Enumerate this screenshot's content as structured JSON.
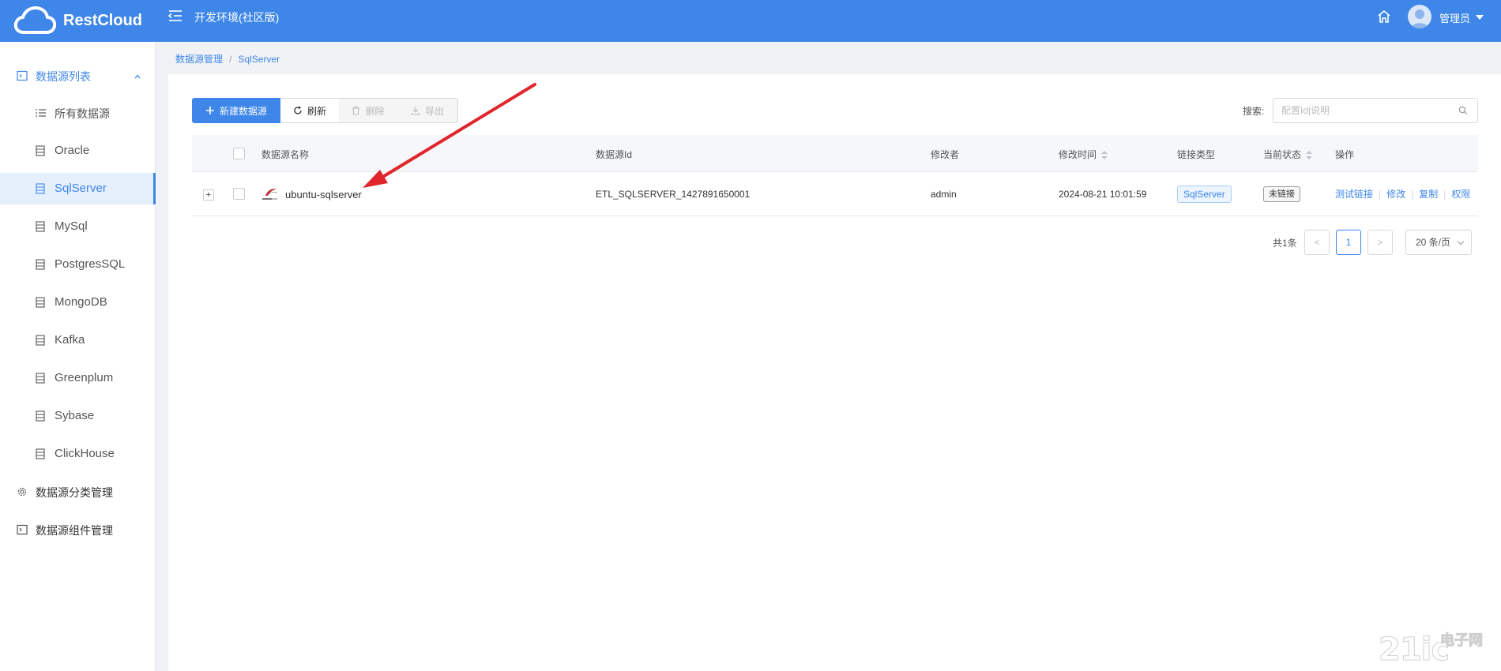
{
  "header": {
    "brand": "RestCloud",
    "env_title": "开发环境(社区版)",
    "user_name": "管理员"
  },
  "sidebar": {
    "group_datasource_list": "数据源列表",
    "items": [
      {
        "label": "所有数据源",
        "icon": "list-icon"
      },
      {
        "label": "Oracle",
        "icon": "db-icon"
      },
      {
        "label": "SqlServer",
        "icon": "db-icon",
        "active": true
      },
      {
        "label": "MySql",
        "icon": "db-icon"
      },
      {
        "label": "PostgresSQL",
        "icon": "db-icon"
      },
      {
        "label": "MongoDB",
        "icon": "db-icon"
      },
      {
        "label": "Kafka",
        "icon": "db-icon"
      },
      {
        "label": "Greenplum",
        "icon": "db-icon"
      },
      {
        "label": "Sybase",
        "icon": "db-icon"
      },
      {
        "label": "ClickHouse",
        "icon": "db-icon"
      }
    ],
    "group_category": "数据源分类管理",
    "group_component": "数据源组件管理"
  },
  "breadcrumb": {
    "parent": "数据源管理",
    "sep": "/",
    "current": "SqlServer"
  },
  "toolbar": {
    "new_label": "新建数据源",
    "refresh_label": "刷新",
    "delete_label": "删除",
    "export_label": "导出",
    "search_label": "搜索:",
    "search_placeholder": "配置Id|说明",
    "search_value": ""
  },
  "table": {
    "columns": {
      "name": "数据源名称",
      "id": "数据源Id",
      "modifier": "修改者",
      "modified_time": "修改时间",
      "link_type": "链接类型",
      "status": "当前状态",
      "actions": "操作"
    },
    "rows": [
      {
        "expand": "+",
        "name": "ubuntu-sqlserver",
        "id": "ETL_SQLSERVER_1427891650001",
        "modifier": "admin",
        "modified_time": "2024-08-21 10:01:59",
        "link_type": "SqlServer",
        "status": "未链接",
        "actions": [
          "测试链接",
          "修改",
          "复制",
          "权限"
        ]
      }
    ]
  },
  "pagination": {
    "total": "共1条",
    "prev": "<",
    "current_page": "1",
    "next": ">",
    "page_size": "20 条/页"
  },
  "colors": {
    "header": "#3e86e8",
    "accent": "#3e86e8",
    "annotation_arrow": "#e0262c"
  },
  "watermark": {
    "main": "21ic",
    "cn": "电子网"
  }
}
